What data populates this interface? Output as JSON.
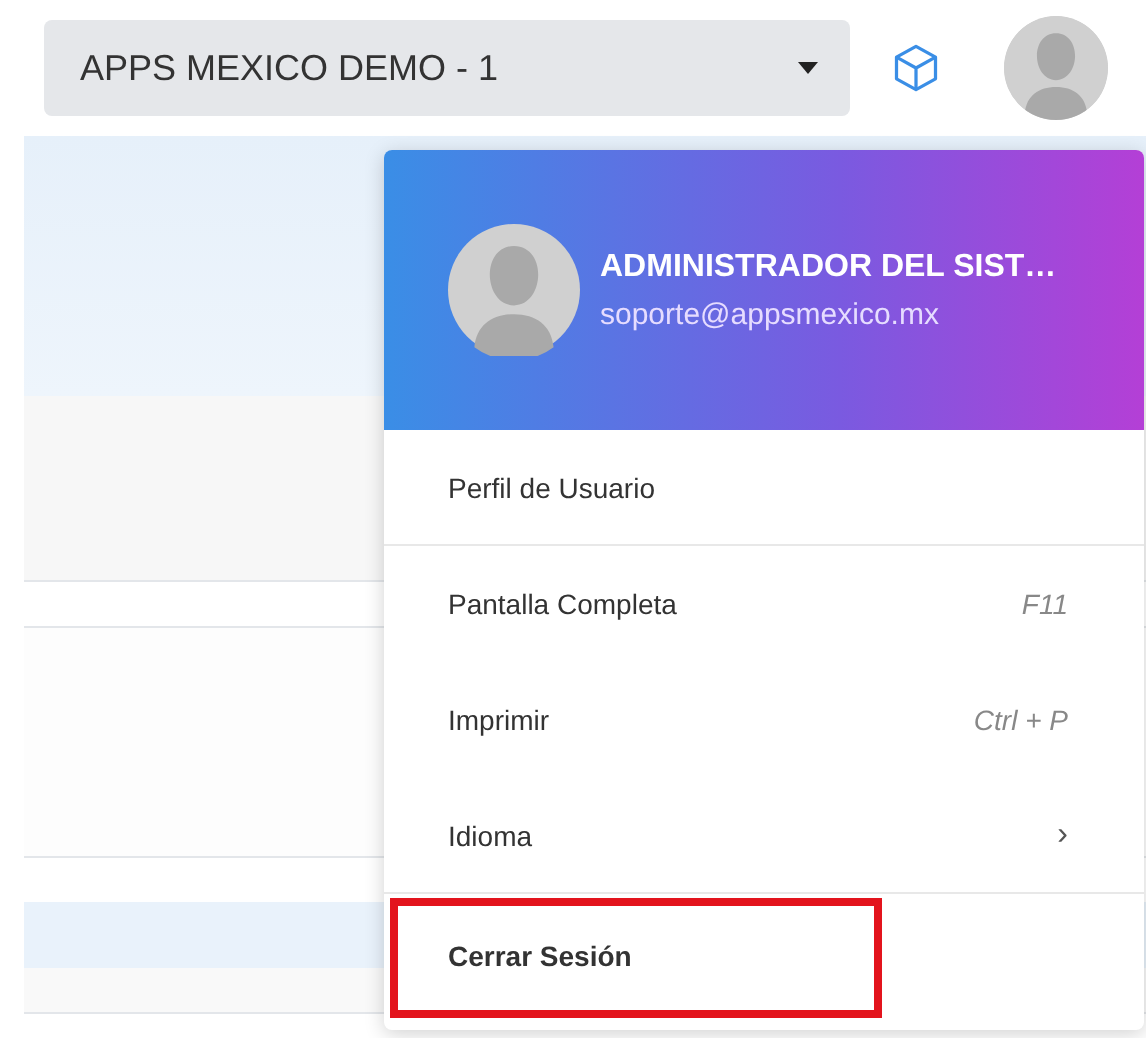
{
  "topbar": {
    "company_select": {
      "value": "APPS MEXICO DEMO - 1"
    }
  },
  "user_menu": {
    "open": true,
    "header": {
      "name": "ADMINISTRADOR DEL SIST…",
      "email": "soporte@appsmexico.mx"
    },
    "items": [
      {
        "kind": "plain",
        "label": "Perfil de Usuario",
        "separator_after": true,
        "highlighted": false
      },
      {
        "kind": "shortcut",
        "label": "Pantalla Completa",
        "shortcut": "F11",
        "separator_after": false,
        "highlighted": false
      },
      {
        "kind": "shortcut",
        "label": "Imprimir",
        "shortcut": "Ctrl + P",
        "separator_after": false,
        "highlighted": false
      },
      {
        "kind": "submenu",
        "label": "Idioma",
        "arrow": "›",
        "separator_after": true,
        "highlighted": false
      },
      {
        "kind": "action",
        "label": "Cerrar Sesión",
        "separator_after": false,
        "highlighted": true
      }
    ]
  }
}
